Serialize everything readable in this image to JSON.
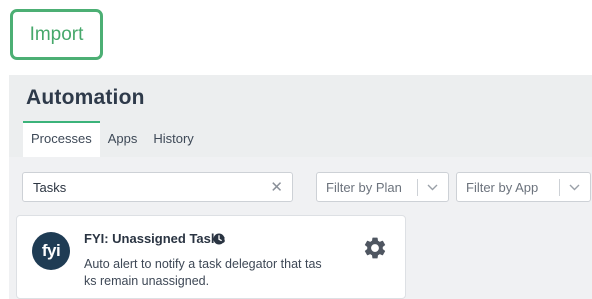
{
  "import_button": {
    "label": "Import"
  },
  "automation": {
    "title": "Automation",
    "tabs": [
      {
        "label": "Processes",
        "active": true
      },
      {
        "label": "Apps",
        "active": false
      },
      {
        "label": "History",
        "active": false
      }
    ]
  },
  "filters": {
    "search_value": "Tasks",
    "clear_icon": "close-icon",
    "plan_label": "Filter by Plan",
    "app_label": "Filter by App"
  },
  "process_card": {
    "logo_text": "fyi",
    "title": "FYI: Unassigned Tasks",
    "description": "Auto alert to notify a task delegator that tasks remain unassigned.",
    "status_icon": "clock-icon",
    "settings_icon": "gear-icon"
  },
  "colors": {
    "accent_green": "#46a86b",
    "logo_navy": "#1f3c54",
    "panel_bg": "#f0f1f3"
  }
}
